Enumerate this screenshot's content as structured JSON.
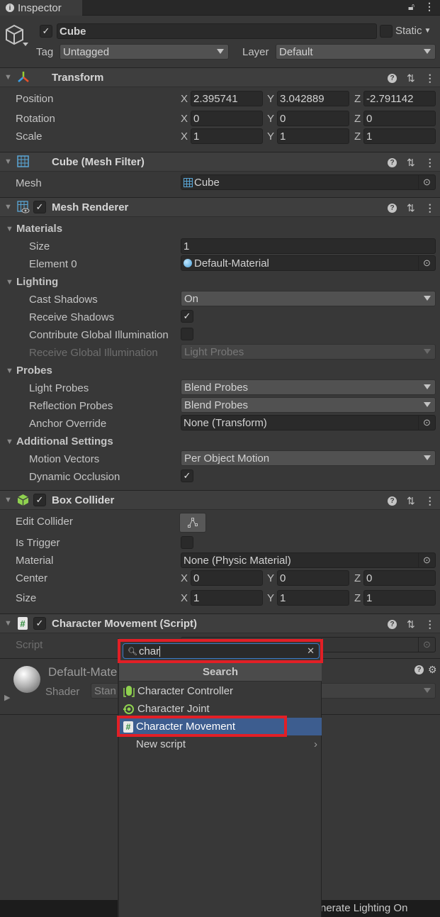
{
  "tab": {
    "title": "Inspector",
    "lock_icon": "lock-icon",
    "menu_icon": "kebab-icon"
  },
  "object": {
    "name": "Cube",
    "active": true,
    "static_label": "Static",
    "static": false,
    "tag_label": "Tag",
    "tag_value": "Untagged",
    "layer_label": "Layer",
    "layer_value": "Default"
  },
  "transform": {
    "title": "Transform",
    "rows": [
      {
        "label": "Position",
        "x": "2.395741",
        "y": "3.042889",
        "z": "-2.791142"
      },
      {
        "label": "Rotation",
        "x": "0",
        "y": "0",
        "z": "0"
      },
      {
        "label": "Scale",
        "x": "1",
        "y": "1",
        "z": "1"
      }
    ]
  },
  "axes": {
    "x": "X",
    "y": "Y",
    "z": "Z"
  },
  "mesh_filter": {
    "title": "Cube (Mesh Filter)",
    "mesh_label": "Mesh",
    "mesh_value": "Cube"
  },
  "mesh_renderer": {
    "title": "Mesh Renderer",
    "enabled": true,
    "materials": {
      "header": "Materials",
      "size_label": "Size",
      "size_value": "1",
      "element0_label": "Element 0",
      "element0_value": "Default-Material"
    },
    "lighting": {
      "header": "Lighting",
      "cast_shadows_label": "Cast Shadows",
      "cast_shadows_value": "On",
      "receive_shadows_label": "Receive Shadows",
      "receive_shadows": true,
      "contribute_gi_label": "Contribute Global Illumination",
      "contribute_gi": false,
      "receive_gi_label": "Receive Global Illumination",
      "receive_gi_value": "Light Probes"
    },
    "probes": {
      "header": "Probes",
      "light_probes_label": "Light Probes",
      "light_probes_value": "Blend Probes",
      "reflection_probes_label": "Reflection Probes",
      "reflection_probes_value": "Blend Probes",
      "anchor_override_label": "Anchor Override",
      "anchor_override_value": "None (Transform)"
    },
    "additional": {
      "header": "Additional Settings",
      "motion_vectors_label": "Motion Vectors",
      "motion_vectors_value": "Per Object Motion",
      "dynamic_occlusion_label": "Dynamic Occlusion",
      "dynamic_occlusion": true
    }
  },
  "box_collider": {
    "title": "Box Collider",
    "enabled": true,
    "edit_collider_label": "Edit Collider",
    "is_trigger_label": "Is Trigger",
    "is_trigger": false,
    "material_label": "Material",
    "material_value": "None (Physic Material)",
    "center_label": "Center",
    "center": {
      "x": "0",
      "y": "0",
      "z": "0"
    },
    "size_label": "Size",
    "size": {
      "x": "1",
      "y": "1",
      "z": "1"
    }
  },
  "script_component": {
    "title": "Character Movement (Script)",
    "enabled": true,
    "script_label": "Script"
  },
  "material_preview": {
    "name": "Default-Mate",
    "shader_label": "Shader",
    "shader_value": "Stan"
  },
  "add_component_popup": {
    "search_value": "char",
    "header": "Search",
    "items": [
      {
        "label": "Character Controller",
        "icon": "character-controller-icon"
      },
      {
        "label": "Character Joint",
        "icon": "character-joint-icon"
      },
      {
        "label": "Character Movement",
        "icon": "script-icon",
        "selected": true
      },
      {
        "label": "New script",
        "icon": "",
        "submenu": true
      }
    ]
  },
  "status_bar": {
    "text": "nerate Lighting On"
  },
  "colors": {
    "highlight": "#e21f26",
    "selection": "#3d5d8f"
  }
}
